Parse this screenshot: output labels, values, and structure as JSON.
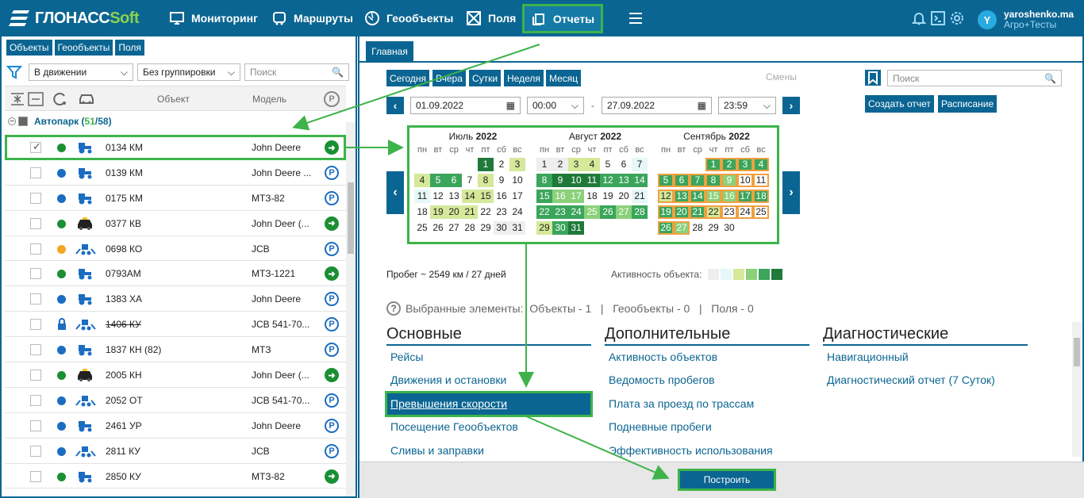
{
  "app": {
    "logo_main": "ГЛОНАСС",
    "logo_soft": "Soft"
  },
  "nav": {
    "monitoring": "Мониторинг",
    "routes": "Маршруты",
    "geoobjects": "Геообъекты",
    "fields": "Поля",
    "reports": "Отчеты"
  },
  "user": {
    "name": "yaroshenko.ma",
    "org": "Агро+Тесты",
    "initial": "Y"
  },
  "left": {
    "tabs": [
      "Объекты",
      "Геообъекты",
      "Поля"
    ],
    "filter_motion": "В движении",
    "filter_group": "Без группировки",
    "search_placeholder": "Поиск",
    "col_object": "Объект",
    "col_model": "Модель",
    "group_name": "Автопарк",
    "group_count_active": "51",
    "group_count_total": "58",
    "rows": [
      {
        "num": "0134 КМ",
        "model": "John Deere",
        "status": "#1a8f33",
        "act": "go",
        "icon": "tractor-icon"
      },
      {
        "num": "0139 КМ",
        "model": "John Deere ...",
        "status": "#1b6dc1",
        "act": "park",
        "icon": "tractor-icon"
      },
      {
        "num": "0175 КМ",
        "model": "МТЗ-82",
        "status": "#1b6dc1",
        "act": "park",
        "icon": "tractor-icon"
      },
      {
        "num": "0377 КВ",
        "model": "John Deer (...",
        "status": "#1a8f33",
        "act": "go",
        "icon": "car-icon"
      },
      {
        "num": "0698 КО",
        "model": "JCB",
        "status": "#f5a623",
        "act": "park",
        "icon": "loader-icon"
      },
      {
        "num": "0793АМ",
        "model": "МТЗ-1221",
        "status": "#1a8f33",
        "act": "go",
        "icon": "tractor-icon"
      },
      {
        "num": "1383 ХА",
        "model": "John Deere",
        "status": "#1b6dc1",
        "act": "park",
        "icon": "tractor-icon"
      },
      {
        "num": "1406 КУ",
        "model": "JCB 541-70...",
        "status": "lock",
        "act": "park",
        "icon": "loader-icon"
      },
      {
        "num": "1837 КН (82)",
        "model": "МТЗ",
        "status": "#1b6dc1",
        "act": "park",
        "icon": "tractor-icon"
      },
      {
        "num": "2005 КН",
        "model": "John Deer (...",
        "status": "#1a8f33",
        "act": "go",
        "icon": "car-icon"
      },
      {
        "num": "2052 ОТ",
        "model": "JCB 541-70...",
        "status": "#1b6dc1",
        "act": "park",
        "icon": "loader-icon"
      },
      {
        "num": "2461 УР",
        "model": "John Deere",
        "status": "#1b6dc1",
        "act": "park",
        "icon": "tractor-icon"
      },
      {
        "num": "2811 КУ",
        "model": "JCB",
        "status": "#1b6dc1",
        "act": "park",
        "icon": "loader-icon"
      },
      {
        "num": "2850 КУ",
        "model": "МТЗ-82",
        "status": "#1a8f33",
        "act": "go",
        "icon": "tractor-icon"
      }
    ]
  },
  "right": {
    "tab": "Главная",
    "quick": [
      "Сегодня",
      "Вчера",
      "Сутки",
      "Неделя",
      "Месяц"
    ],
    "shifts": "Смены",
    "search_placeholder": "Поиск",
    "create_report": "Создать отчет",
    "schedule": "Расписание",
    "date_from": "01.09.2022",
    "time_from": "00:00",
    "date_to": "27.09.2022",
    "time_to": "23:59",
    "dash": "-",
    "weekdays": [
      "пн",
      "вт",
      "ср",
      "чт",
      "пт",
      "сб",
      "вс"
    ],
    "months": [
      {
        "name": "Июль",
        "year": "2022"
      },
      {
        "name": "Август",
        "year": "2022"
      },
      {
        "name": "Сентябрь",
        "year": "2022"
      }
    ],
    "mileage": "Пробег ~ 2549 км / 27 дней",
    "activity_label": "Активность объекта:",
    "selected_label": "Выбранные элементы:",
    "selected_objects": "Объекты - 1",
    "selected_geo": "Геообъекты - 0",
    "selected_fields": "Поля - 0",
    "sep": "|",
    "cat_main": "Основные",
    "cat_extra": "Дополнительные",
    "cat_diag": "Диагностические",
    "main_items": [
      "Рейсы",
      "Движения и остановки",
      "Превышения скорости",
      "Посещение Геообъектов",
      "Сливы и заправки"
    ],
    "extra_items": [
      "Активность объектов",
      "Ведомость пробегов",
      "Плата за проезд по трассам",
      "Подневные пробеги",
      "Эффективность использования"
    ],
    "diag_items": [
      "Навигационный",
      "Диагностический отчет (7 Суток)"
    ],
    "build": "Построить"
  }
}
